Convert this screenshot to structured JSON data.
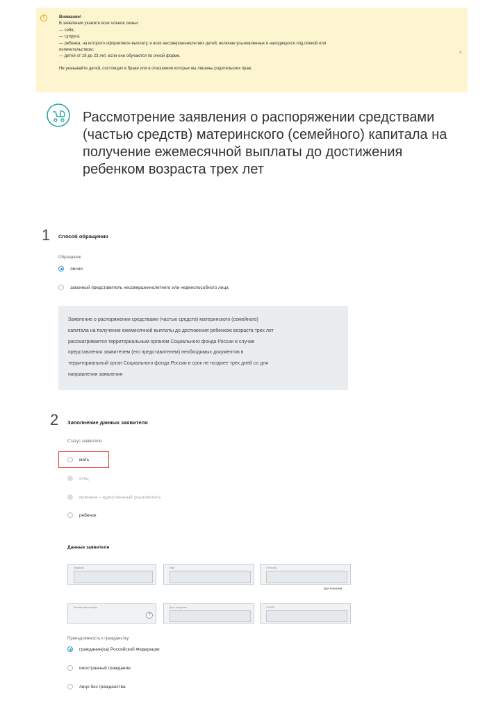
{
  "alert": {
    "title": "Внимание!",
    "lines": [
      "В заявлении укажите всех членов семьи:",
      "— себя;",
      "— супруга;",
      "— ребенка, на которого оформляете выплату, и всех несовершеннолетних детей, включая усыновленных и находящихся под опекой или",
      "попечительством;",
      "— детей от 18 до 23 лет, если они обучаются по очной форме."
    ],
    "note": "Не указывайте детей, состоящих в браке или в отношении которых вы лишены родительских прав.",
    "close": "×",
    "icon_glyph": "!"
  },
  "header": {
    "icon": "baby-stroller-icon",
    "title": "Рассмотрение заявления о распоряжении средствами (частью средств) материнского (семейного) капитала на получение ежемесячной выплаты до достижения ребенком возраста трех лет"
  },
  "step1": {
    "number": "1",
    "title": "Способ обращения",
    "group_label": "Обращение",
    "options": [
      "лично",
      "законный представитель несовершеннолетнего или недееспособного лица"
    ],
    "info": [
      "Заявление о распоряжении средствами (частью средств) материнского (семейного)",
      "капитала на получение ежемесячной выплаты до достижения ребенком возраста трех лет",
      "рассматривается территориальным органом Социального фонда России в случае",
      "представления заявителем (его представителем) необходимых документов в",
      "территориальный орган Социального фонда России в срок не позднее трех дней со дня",
      "направления заявления"
    ]
  },
  "step2": {
    "number": "2",
    "title": "Заполнение данных заявителя",
    "status_label": "Статус заявителя",
    "status_options": [
      "мать",
      "отец",
      "мужчина – единственный усыновитель",
      "ребенок"
    ],
    "applicant_title": "Данные заявителя",
    "fields": {
      "surname": "Фамилия",
      "name": "Имя",
      "patronymic": "Отчество",
      "patronymic_hint": "при наличии",
      "phone": "Контактный телефон",
      "phone_help": "?",
      "birthdate": "Дата рождения",
      "snils": "СНИЛС"
    },
    "citizenship_label": "Принадлежность к гражданству",
    "citizenship_options": [
      "гражданин(ка) Российской Федерации",
      "иностранный гражданин",
      "лицо без гражданства"
    ]
  },
  "colors": {
    "accent": "#2a95c9",
    "alert_bg": "#fdf5d0",
    "highlight": "#e53935",
    "icon": "#2aa5a8"
  }
}
